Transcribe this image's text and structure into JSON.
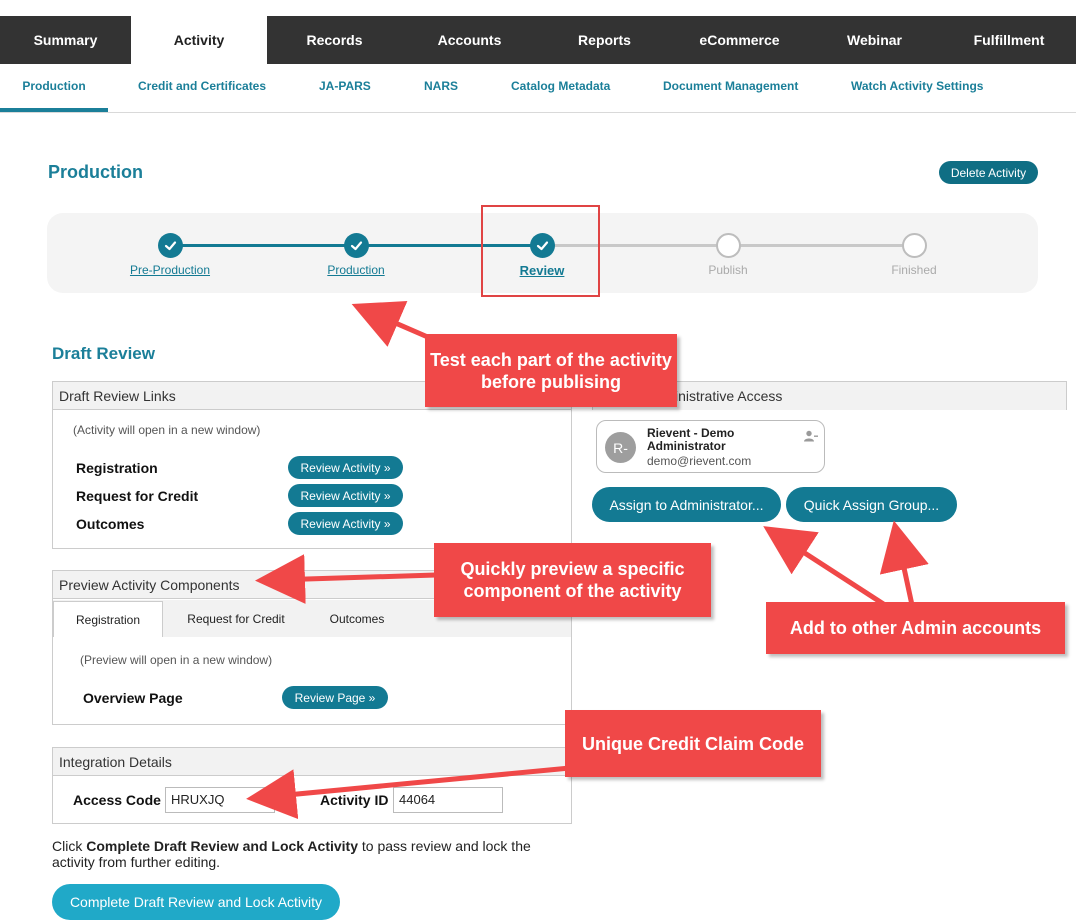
{
  "top_tabs": [
    {
      "label": "Summary"
    },
    {
      "label": "Activity"
    },
    {
      "label": "Records"
    },
    {
      "label": "Accounts"
    },
    {
      "label": "Reports"
    },
    {
      "label": "eCommerce"
    },
    {
      "label": "Webinar"
    },
    {
      "label": "Fulfillment"
    }
  ],
  "sub_tabs": [
    {
      "label": "Production"
    },
    {
      "label": "Credit and Certificates"
    },
    {
      "label": "JA-PARS"
    },
    {
      "label": "NARS"
    },
    {
      "label": "Catalog Metadata"
    },
    {
      "label": "Document Management"
    },
    {
      "label": "Watch Activity Settings"
    }
  ],
  "page": {
    "title": "Production",
    "delete_label": "Delete Activity"
  },
  "stepper": {
    "steps": [
      {
        "label": "Pre-Production"
      },
      {
        "label": "Production"
      },
      {
        "label": "Review"
      },
      {
        "label": "Publish"
      },
      {
        "label": "Finished"
      }
    ]
  },
  "draft_review": {
    "title": "Draft Review",
    "links_panel": {
      "title": "Draft Review Links",
      "note": "(Activity will open in a new window)",
      "rows": [
        {
          "label": "Registration",
          "button": "Review Activity »"
        },
        {
          "label": "Request for Credit",
          "button": "Review Activity »"
        },
        {
          "label": "Outcomes",
          "button": "Review Activity »"
        }
      ]
    },
    "preview_panel": {
      "title": "Preview Activity Components",
      "tabs": [
        {
          "label": "Registration"
        },
        {
          "label": "Request for Credit"
        },
        {
          "label": "Outcomes"
        }
      ],
      "note": "(Preview will open in a new window)",
      "row_label": "Overview Page",
      "row_button": "Review Page »"
    },
    "integration_panel": {
      "title": "Integration Details",
      "access_code_label": "Access Code",
      "access_code_value": "HRUXJQ",
      "activity_id_label": "Activity ID",
      "activity_id_value": "44064"
    }
  },
  "admin": {
    "panel_title": "inistrative Access",
    "avatar_initials": "R-",
    "name": "Rievent - Demo Administrator",
    "email": "demo@rievent.com",
    "assign_button": "Assign to Administrator...",
    "quick_assign_button": "Quick Assign Group..."
  },
  "footer": {
    "text_prefix": "Click ",
    "text_bold": "Complete Draft Review and Lock Activity",
    "text_suffix": " to pass review and lock the activity from further editing.",
    "button": "Complete Draft Review and Lock Activity"
  },
  "annotations": {
    "test_each": "Test each part of the activity before publising",
    "quick_preview": "Quickly preview a specific component of the activity",
    "add_admin": "Add to other Admin accounts",
    "credit_code": "Unique Credit Claim Code"
  },
  "colors": {
    "accent": "#137a93",
    "callout": "#f04848",
    "topnav": "#333333"
  }
}
